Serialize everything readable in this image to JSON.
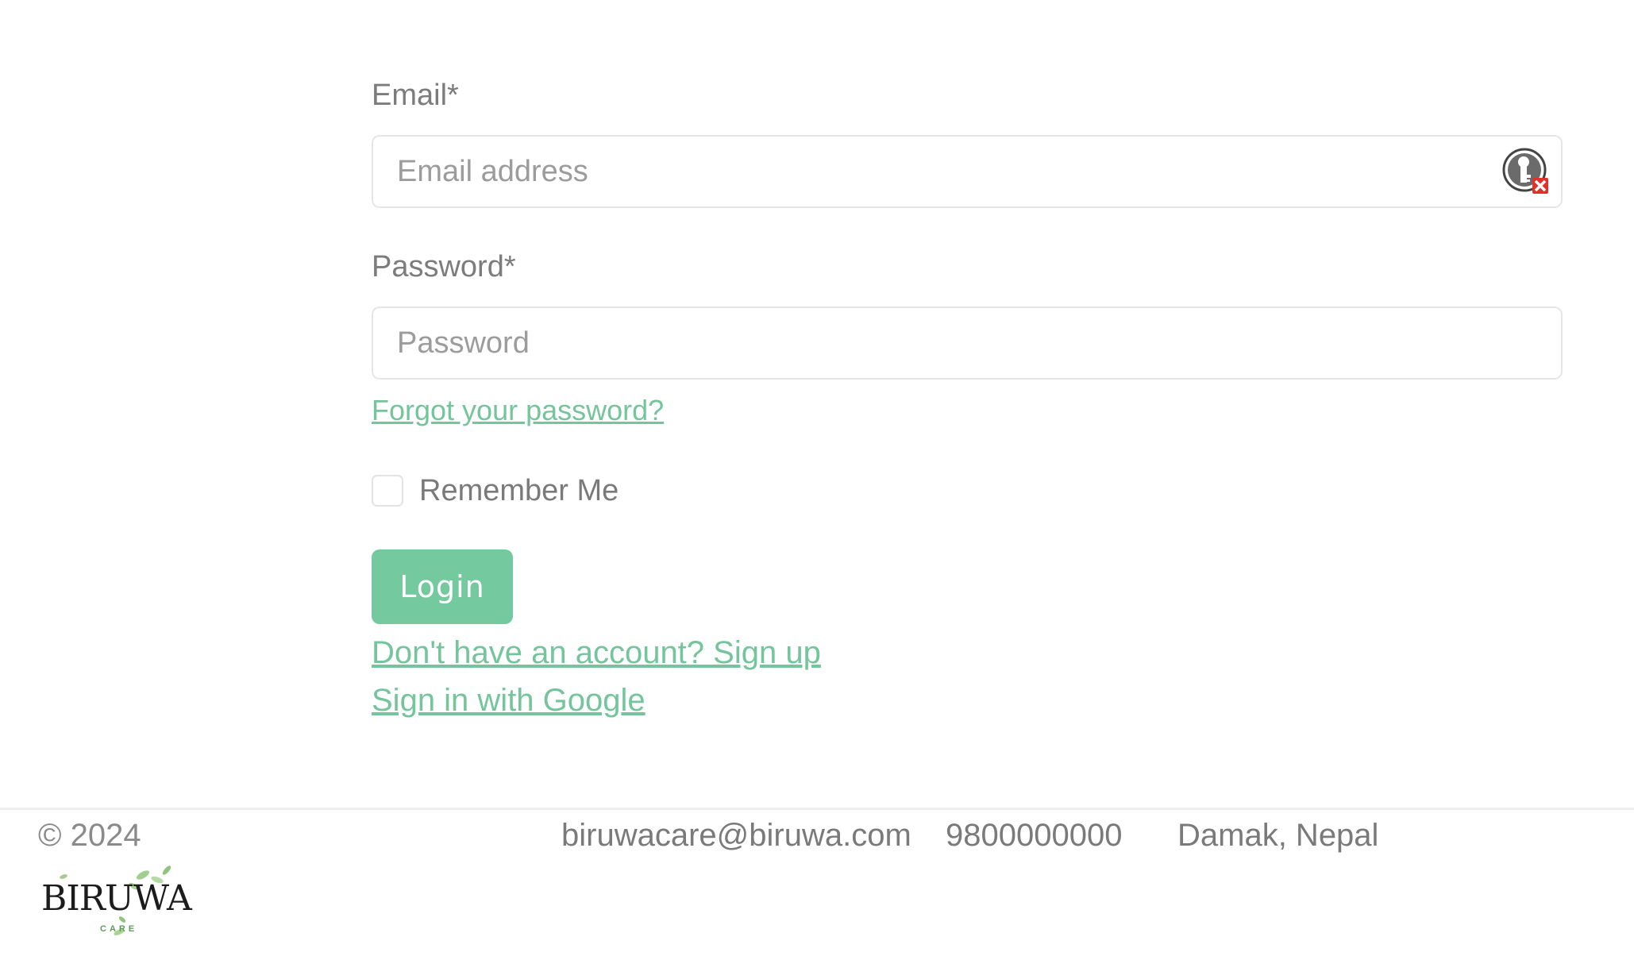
{
  "form": {
    "email_label": "Email*",
    "email_placeholder": "Email address",
    "password_label": "Password*",
    "password_placeholder": "Password",
    "forgot_password": "Forgot your password?",
    "remember_me": "Remember Me",
    "login_button": "Login",
    "signup_link": "Don't have an account? Sign up",
    "google_link": "Sign in with Google"
  },
  "footer": {
    "copyright": "© 2024",
    "email": "biruwacare@biruwa.com",
    "phone": "9800000000",
    "location": "Damak, Nepal",
    "logo_text": "BIRUWA",
    "logo_subtext": "CARE"
  },
  "colors": {
    "accent": "#75c99f",
    "link": "#74c49c",
    "text": "#7a7a7a"
  },
  "icons": {
    "password_manager": "password-manager-key-icon"
  }
}
